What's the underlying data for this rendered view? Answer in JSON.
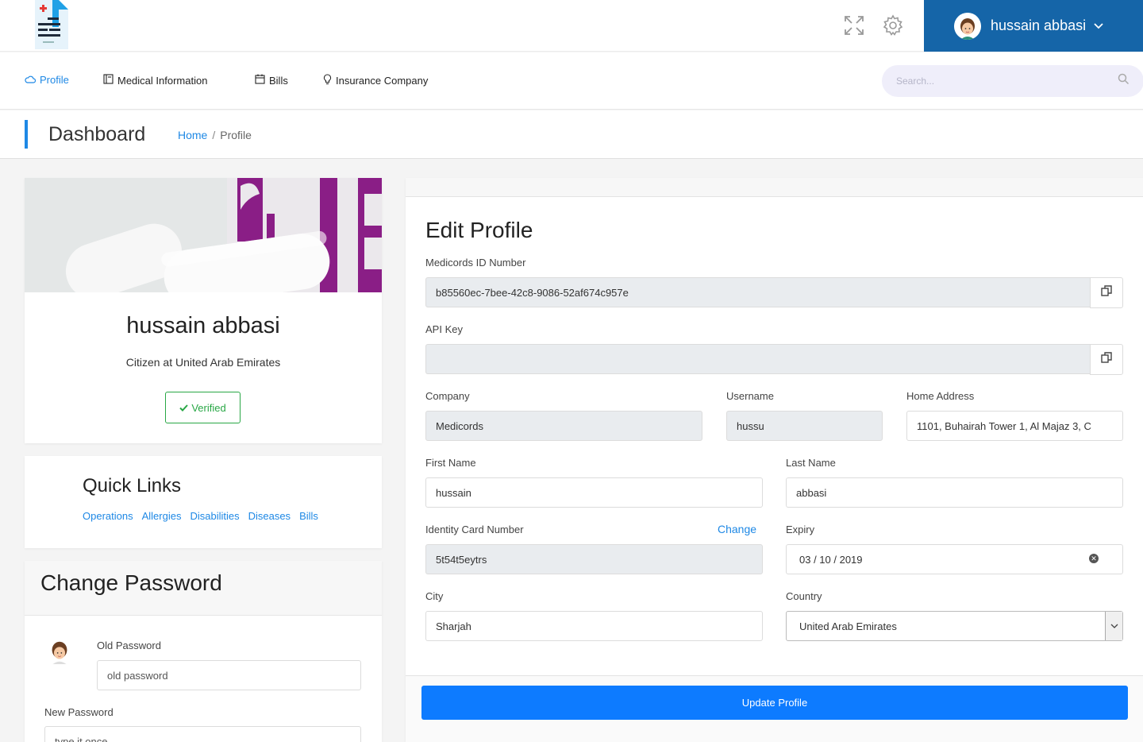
{
  "header": {
    "user_name": "hussain abbasi",
    "icons": [
      "fullscreen-icon",
      "settings-icon",
      "chevron-down-icon"
    ]
  },
  "nav": {
    "items": [
      {
        "label": "Profile",
        "icon": "cloud-icon",
        "active": true
      },
      {
        "label": "Medical Information",
        "icon": "book-icon",
        "active": false
      },
      {
        "label": "Bills",
        "icon": "calendar-icon",
        "active": false
      },
      {
        "label": "Insurance Company",
        "icon": "bulb-icon",
        "active": false
      }
    ],
    "search_placeholder": "Search..."
  },
  "titlebar": {
    "title": "Dashboard",
    "breadcrumb_home": "Home",
    "breadcrumb_current": "Profile"
  },
  "profile_card": {
    "name": "hussain abbasi",
    "role": "Citizen at United Arab Emirates",
    "verified_label": "Verified"
  },
  "quick_links": {
    "title": "Quick Links",
    "links": [
      "Operations",
      "Allergies",
      "Disabilities",
      "Diseases",
      "Bills"
    ]
  },
  "change_password": {
    "title": "Change Password",
    "old_label": "Old Password",
    "old_placeholder": "old password",
    "new_label": "New Password",
    "new_placeholder": "type it once"
  },
  "edit_profile": {
    "title": "Edit Profile",
    "medicords_id_label": "Medicords ID Number",
    "medicords_id_value": "b85560ec-7bee-42c8-9086-52af674c957e",
    "api_key_label": "API Key",
    "api_key_value": "",
    "company_label": "Company",
    "company_value": "Medicords",
    "username_label": "Username",
    "username_value": "hussu",
    "address_label": "Home Address",
    "address_value": "1101, Buhairah Tower 1, Al Majaz 3, C",
    "first_name_label": "First Name",
    "first_name_value": "hussain",
    "last_name_label": "Last Name",
    "last_name_value": "abbasi",
    "id_card_label": "Identity Card Number",
    "id_card_value": "5t54t5eytrs",
    "change_label": "Change",
    "expiry_label": "Expiry",
    "expiry_value": "03 / 10 / 2019",
    "city_label": "City",
    "city_value": "Sharjah",
    "country_label": "Country",
    "country_value": "United Arab Emirates",
    "update_button": "Update Profile"
  },
  "colors": {
    "accent": "#1e88e5",
    "user_bar": "#1565a8",
    "update_button": "#0d7bff",
    "verified": "#28a745"
  }
}
